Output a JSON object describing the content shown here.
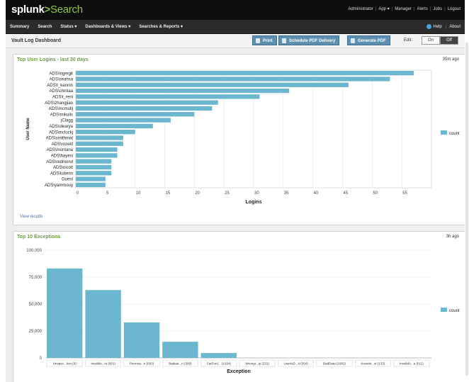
{
  "app": {
    "brand": "splunk",
    "separator": ">",
    "app_name": "Search"
  },
  "top_links": [
    "Administrator",
    "App ▾",
    "Manager",
    "Alerts",
    "Jobs",
    "Logout"
  ],
  "nav": {
    "left": [
      "Summary",
      "Search",
      "Status ▾",
      "Dashboards & Views ▾",
      "Searches & Reports ▾"
    ],
    "help": "Help",
    "about": "About"
  },
  "toolbar": {
    "dashboard_title": "Vault Log Dashboard",
    "print_label": "Print",
    "schedule_label": "Schedule PDF Delivery",
    "generate_label": "Generate PDF",
    "edit_label": "Edit:",
    "on_label": "On",
    "off_label": "Off"
  },
  "panel1": {
    "title": "Top User Logins - last 30 days",
    "time": "35m ago",
    "view_results": "View results"
  },
  "panel2": {
    "title": "Top 10 Exceptions",
    "time": "3h ago"
  },
  "colors": {
    "bar": "#6bb7cf",
    "panel_title": "#6a9d3a",
    "button": "#5d8fb0"
  },
  "chart_data": [
    {
      "type": "bar",
      "orientation": "horizontal",
      "categories": [
        "ADS\\logergk",
        "ADS\\seahsa",
        "ADS\\t_kannin",
        "ADS\\chintaa",
        "ADS\\t_reni",
        "ADS\\zhangjiao",
        "ADS\\mcmullj",
        "ADS\\mikulis",
        "jClagg",
        "ADS\\olearya",
        "ADS\\mcluckj",
        "ADS\\smithmat",
        "ADS\\rozekt",
        "ADS\\montana",
        "ADS\\hayesi",
        "ADS\\redmond",
        "ADS\\nicolt",
        "ADS\\luttenn",
        "Guest",
        "ADS\\yammouy"
      ],
      "series": [
        {
          "name": "count",
          "values": [
            57,
            53,
            46,
            36,
            31,
            24,
            23,
            20,
            16,
            13,
            10,
            8,
            8,
            7,
            7,
            6,
            6,
            6,
            5,
            5
          ]
        }
      ],
      "xlabel": "Logins",
      "ylabel": "User Name",
      "xlim": [
        0,
        60
      ],
      "xticks": [
        0,
        5,
        10,
        15,
        20,
        25,
        30,
        35,
        40,
        45,
        50,
        55
      ],
      "grid": true,
      "legend": "right"
    },
    {
      "type": "bar",
      "categories": [
        "Unspec...tion (0)",
        "Invalids...nt (001)",
        "Permiss...n (003)",
        "Badaut...n (300)",
        "CatFord... (1024)",
        "Wrongr...ip (222)",
        "UserIsD...d (204)",
        "BadData (1081)",
        "Knowle...st (133)",
        "InvalidA...a (011)"
      ],
      "series": [
        {
          "name": "count",
          "values": [
            83000,
            63000,
            33000,
            15000,
            4500,
            0,
            0,
            0,
            0,
            0
          ]
        }
      ],
      "xlabel": "Exception",
      "ylabel": "",
      "ylim": [
        0,
        100000
      ],
      "yticks": [
        "0",
        "25,000",
        "50,000",
        "75,000",
        "100,000"
      ],
      "grid": true,
      "legend": "right"
    }
  ]
}
